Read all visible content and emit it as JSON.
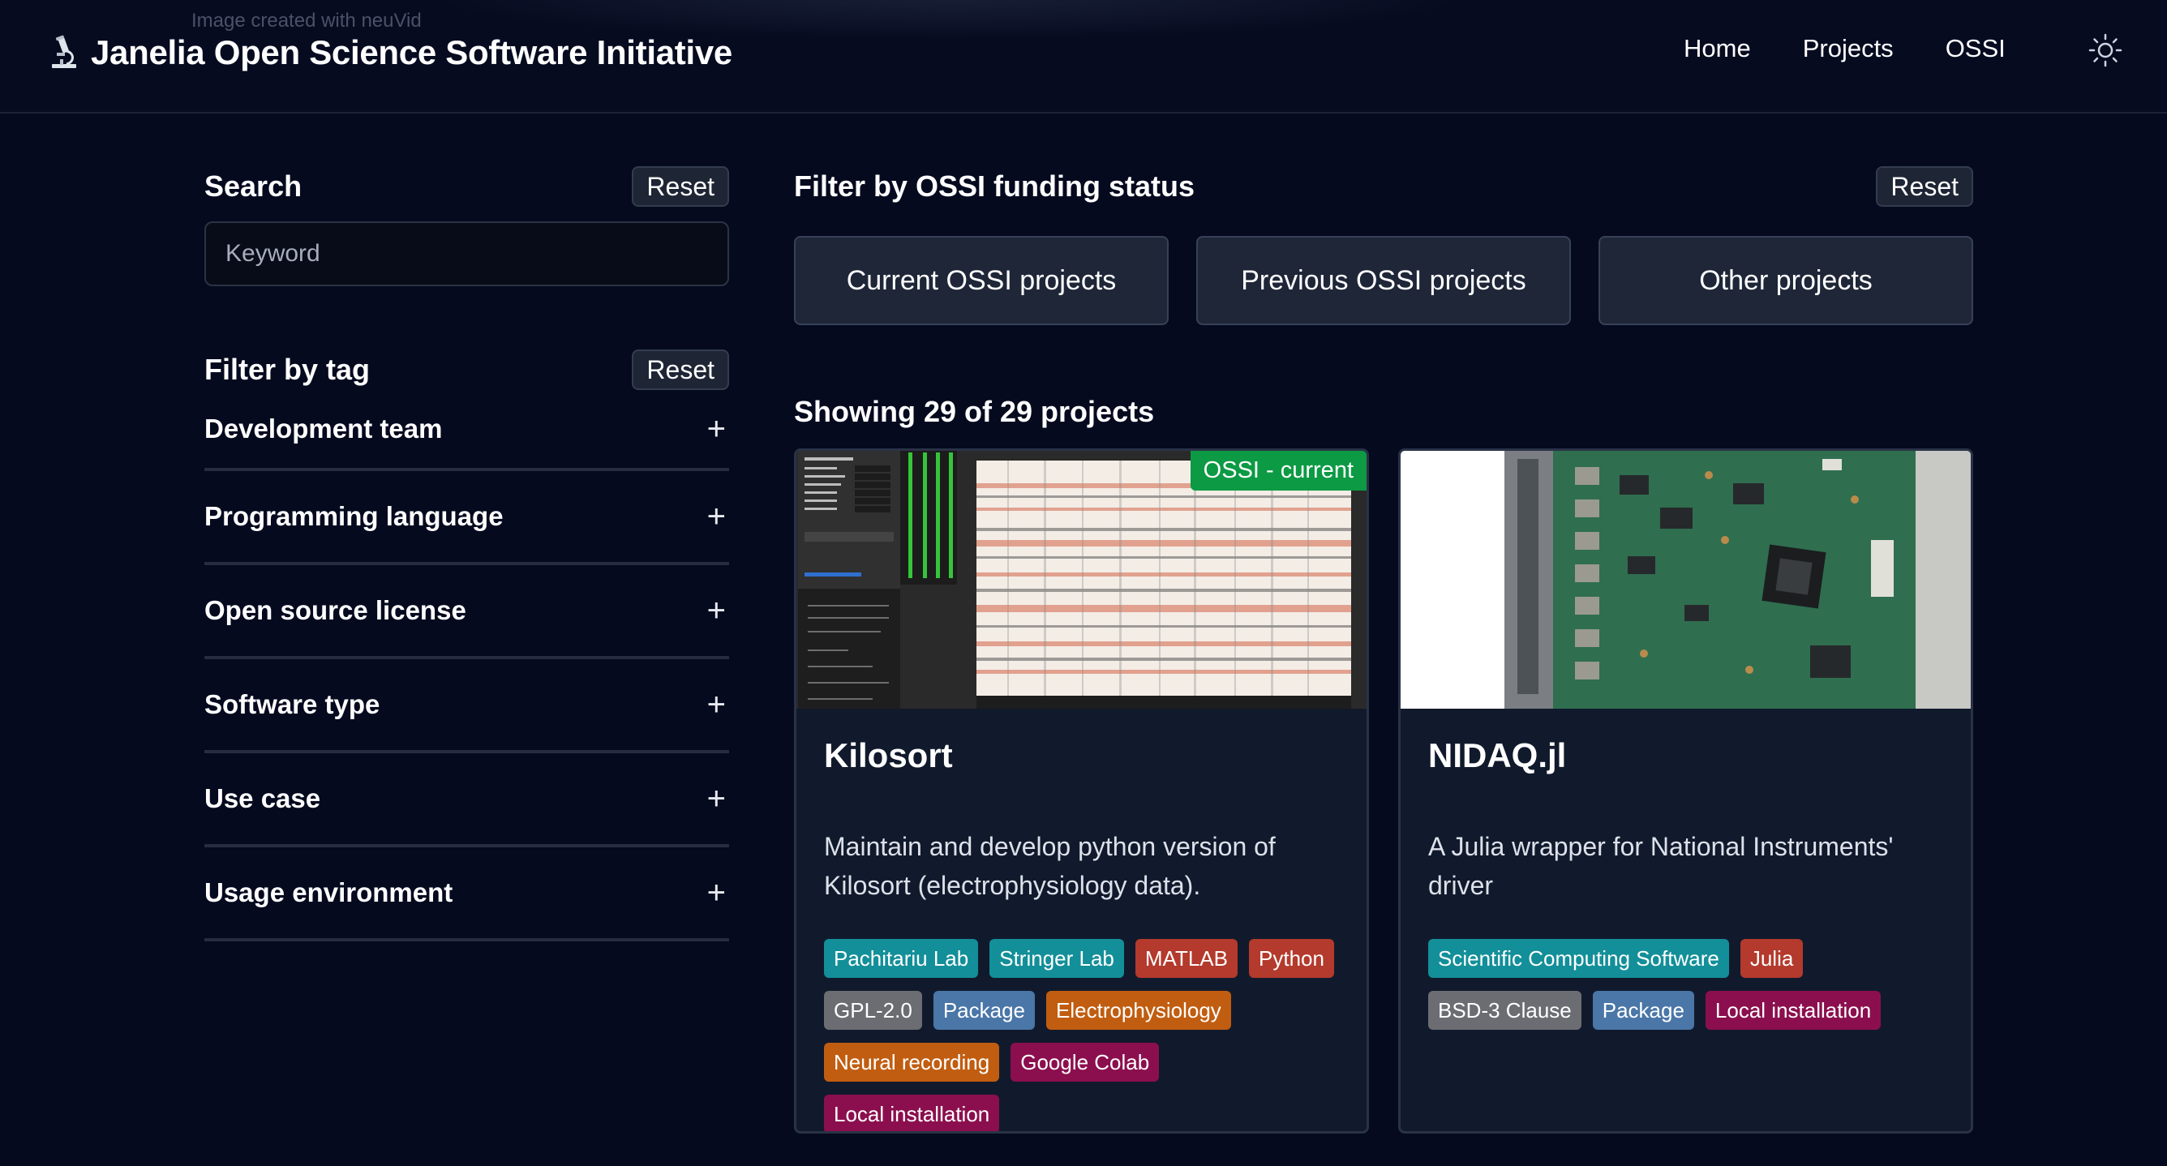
{
  "header": {
    "watermark": "Image created with neuVid",
    "title": "Janelia Open Science Software Initiative",
    "nav": [
      "Home",
      "Projects",
      "OSSI"
    ]
  },
  "sidebar": {
    "search_title": "Search",
    "search_reset": "Reset",
    "search_placeholder": "Keyword",
    "tag_title": "Filter by tag",
    "tag_reset": "Reset",
    "filters": [
      "Development team",
      "Programming language",
      "Open source license",
      "Software type",
      "Use case",
      "Usage environment"
    ],
    "expand_symbol": "+"
  },
  "main": {
    "funding_title": "Filter by OSSI funding status",
    "funding_reset": "Reset",
    "funding_buttons": [
      "Current OSSI projects",
      "Previous OSSI projects",
      "Other projects"
    ],
    "showing": "Showing 29 of 29 projects",
    "cards": [
      {
        "title": "Kilosort",
        "badge": "OSSI - current",
        "description": "Maintain and develop python version of Kilosort (electrophysiology data).",
        "tags": [
          {
            "label": "Pachitariu Lab",
            "color": "#138f99"
          },
          {
            "label": "Stringer Lab",
            "color": "#138f99"
          },
          {
            "label": "MATLAB",
            "color": "#b33a2c"
          },
          {
            "label": "Python",
            "color": "#b33a2c"
          },
          {
            "label": "GPL-2.0",
            "color": "#6b6d72"
          },
          {
            "label": "Package",
            "color": "#4a76a8"
          },
          {
            "label": "Electrophysiology",
            "color": "#c15d10"
          },
          {
            "label": "Neural recording",
            "color": "#c15d10"
          },
          {
            "label": "Google Colab",
            "color": "#8b0f4e"
          },
          {
            "label": "Local installation",
            "color": "#8b0f4e"
          }
        ]
      },
      {
        "title": "NIDAQ.jl",
        "badge": "",
        "description": "A Julia wrapper for National Instruments' driver",
        "tags": [
          {
            "label": "Scientific Computing Software",
            "color": "#138f99"
          },
          {
            "label": "Julia",
            "color": "#b33a2c"
          },
          {
            "label": "BSD-3 Clause",
            "color": "#6b6d72"
          },
          {
            "label": "Package",
            "color": "#4a76a8"
          },
          {
            "label": "Local installation",
            "color": "#8b0f4e"
          }
        ]
      }
    ]
  }
}
